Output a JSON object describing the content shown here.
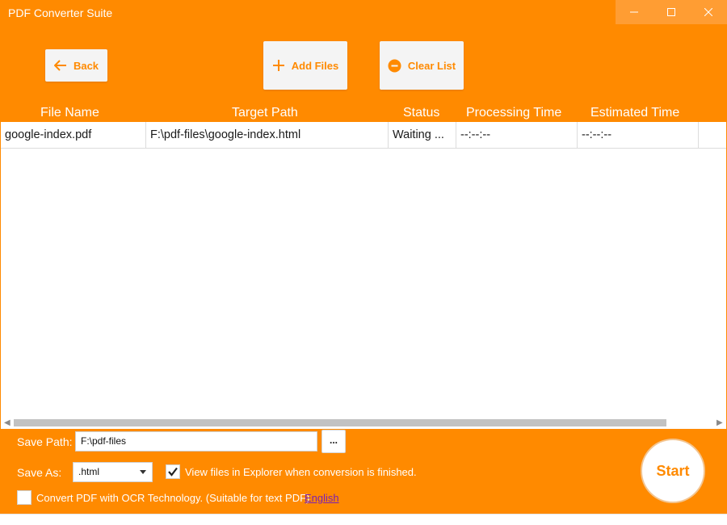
{
  "window": {
    "title": "PDF Converter Suite",
    "controls": [
      "minimize",
      "maximize",
      "close"
    ]
  },
  "toolbar": {
    "back_label": "Back",
    "add_files_label": "Add Files",
    "clear_list_label": "Clear List"
  },
  "table": {
    "columns": [
      "File Name",
      "Target Path",
      "Status",
      "Processing Time",
      "Estimated Time"
    ],
    "rows": [
      {
        "file_name": "google-index.pdf",
        "target_path": "F:\\pdf-files\\google-index.html",
        "status": "Waiting ...",
        "processing_time": "--:--:--",
        "estimated_time": "--:--:--"
      }
    ]
  },
  "settings": {
    "save_path_label": "Save Path:",
    "save_path_value": "F:\\pdf-files",
    "browse_label": "...",
    "save_as_label": "Save As:",
    "save_as_value": ".html",
    "view_in_explorer_label": "View files in Explorer when conversion is finished.",
    "view_in_explorer_checked": true,
    "ocr_label": "Convert PDF with OCR Technology. (Suitable for text PDF)",
    "ocr_checked": false,
    "ocr_language_link": "English",
    "start_label": "Start"
  },
  "theme": {
    "accent": "#ff8a00",
    "button_bg": "#f4f4f4",
    "link": "#7a1fb4"
  }
}
